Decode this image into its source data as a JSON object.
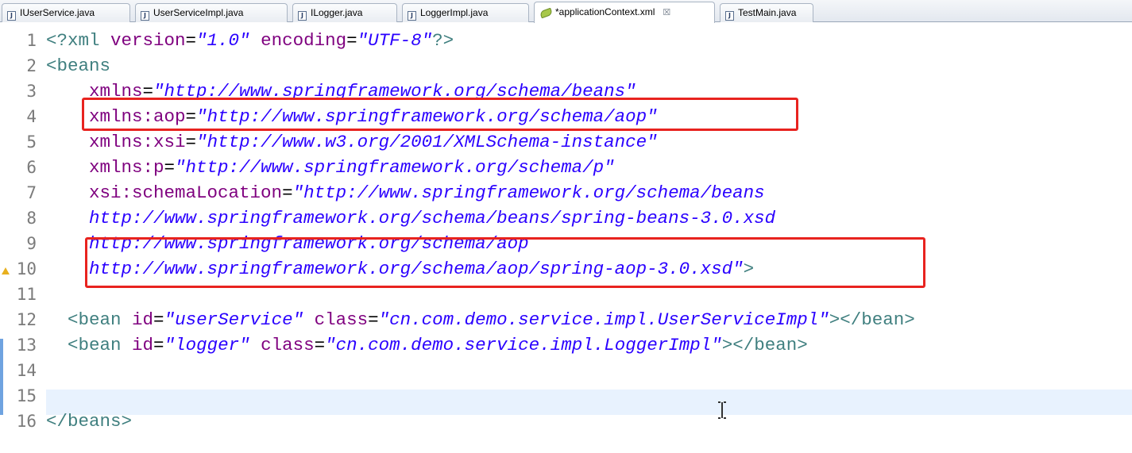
{
  "tabs": [
    {
      "label": "IUserService.java",
      "icon": "java-file-icon",
      "active": false
    },
    {
      "label": "UserServiceImpl.java",
      "icon": "java-file-icon",
      "active": false
    },
    {
      "label": "ILogger.java",
      "icon": "java-file-icon",
      "active": false
    },
    {
      "label": "LoggerImpl.java",
      "icon": "java-file-icon",
      "active": false
    },
    {
      "label": "*applicationContext.xml",
      "icon": "xml-file-icon",
      "active": true,
      "close": "☒"
    },
    {
      "label": "TestMain.java",
      "icon": "java-file-icon",
      "active": false
    }
  ],
  "editor": {
    "lines": [
      {
        "num": "1",
        "tokens": [
          [
            "t-pi",
            "<?xml "
          ],
          [
            "t-attr",
            "version"
          ],
          [
            "t-eq",
            "="
          ],
          [
            "t-str",
            "\"1.0\""
          ],
          [
            "t-pi",
            " "
          ],
          [
            "t-attr",
            "encoding"
          ],
          [
            "t-eq",
            "="
          ],
          [
            "t-str",
            "\"UTF-8\""
          ],
          [
            "t-pi",
            "?>"
          ]
        ]
      },
      {
        "num": "2",
        "tokens": [
          [
            "t-tag",
            "<beans"
          ]
        ]
      },
      {
        "num": "3",
        "tokens": [
          [
            "t-tag",
            "    "
          ],
          [
            "t-attr",
            "xmlns"
          ],
          [
            "t-eq",
            "="
          ],
          [
            "t-str",
            "\"http://www.springframework.org/schema/beans\""
          ]
        ]
      },
      {
        "num": "4",
        "tokens": [
          [
            "t-tag",
            "    "
          ],
          [
            "t-attr",
            "xmlns:aop"
          ],
          [
            "t-eq",
            "="
          ],
          [
            "t-str",
            "\"http://www.springframework.org/schema/aop\""
          ]
        ]
      },
      {
        "num": "5",
        "tokens": [
          [
            "t-tag",
            "    "
          ],
          [
            "t-attr",
            "xmlns:xsi"
          ],
          [
            "t-eq",
            "="
          ],
          [
            "t-str",
            "\"http://www.w3.org/2001/XMLSchema-instance\""
          ]
        ]
      },
      {
        "num": "6",
        "tokens": [
          [
            "t-tag",
            "    "
          ],
          [
            "t-attr",
            "xmlns:p"
          ],
          [
            "t-eq",
            "="
          ],
          [
            "t-str",
            "\"http://www.springframework.org/schema/p\""
          ]
        ]
      },
      {
        "num": "7",
        "tokens": [
          [
            "t-tag",
            "    "
          ],
          [
            "t-attr",
            "xsi:schemaLocation"
          ],
          [
            "t-eq",
            "="
          ],
          [
            "t-str",
            "\"http://www.springframework.org/schema/beans"
          ]
        ]
      },
      {
        "num": "8",
        "tokens": [
          [
            "t-tag",
            "    "
          ],
          [
            "t-str",
            "http://www.springframework.org/schema/beans/spring-beans-3.0.xsd"
          ]
        ]
      },
      {
        "num": "9",
        "tokens": [
          [
            "t-tag",
            "    "
          ],
          [
            "t-str",
            "http://www.springframework.org/schema/aop"
          ]
        ]
      },
      {
        "num": "10",
        "tokens": [
          [
            "t-tag",
            "    "
          ],
          [
            "t-str",
            "http://www.springframework.org/schema/aop/spring-aop-3.0.xsd\""
          ],
          [
            "t-tag",
            ">"
          ]
        ]
      },
      {
        "num": "11",
        "tokens": []
      },
      {
        "num": "12",
        "tokens": [
          [
            "t-tag",
            "  <bean "
          ],
          [
            "t-attr",
            "id"
          ],
          [
            "t-eq",
            "="
          ],
          [
            "t-str",
            "\"userService\""
          ],
          [
            "t-tag",
            " "
          ],
          [
            "t-attr",
            "class"
          ],
          [
            "t-eq",
            "="
          ],
          [
            "t-str",
            "\"cn.com.demo.service.impl.UserServiceImpl\""
          ],
          [
            "t-tag",
            "></bean>"
          ]
        ]
      },
      {
        "num": "13",
        "tokens": [
          [
            "t-tag",
            "  <bean "
          ],
          [
            "t-attr",
            "id"
          ],
          [
            "t-eq",
            "="
          ],
          [
            "t-str",
            "\"logger\""
          ],
          [
            "t-tag",
            " "
          ],
          [
            "t-attr",
            "class"
          ],
          [
            "t-eq",
            "="
          ],
          [
            "t-str",
            "\"cn.com.demo.service.impl.LoggerImpl\""
          ],
          [
            "t-tag",
            "></bean>"
          ]
        ]
      },
      {
        "num": "14",
        "tokens": []
      },
      {
        "num": "15",
        "tokens": []
      },
      {
        "num": "16",
        "tokens": [
          [
            "t-tag",
            "</beans>"
          ]
        ]
      }
    ]
  },
  "colors": {
    "highlight_box": "#e8231f",
    "current_line": "#e8f2fe",
    "change_bar": "#6fa3e0",
    "warning": "#e8b01e"
  }
}
